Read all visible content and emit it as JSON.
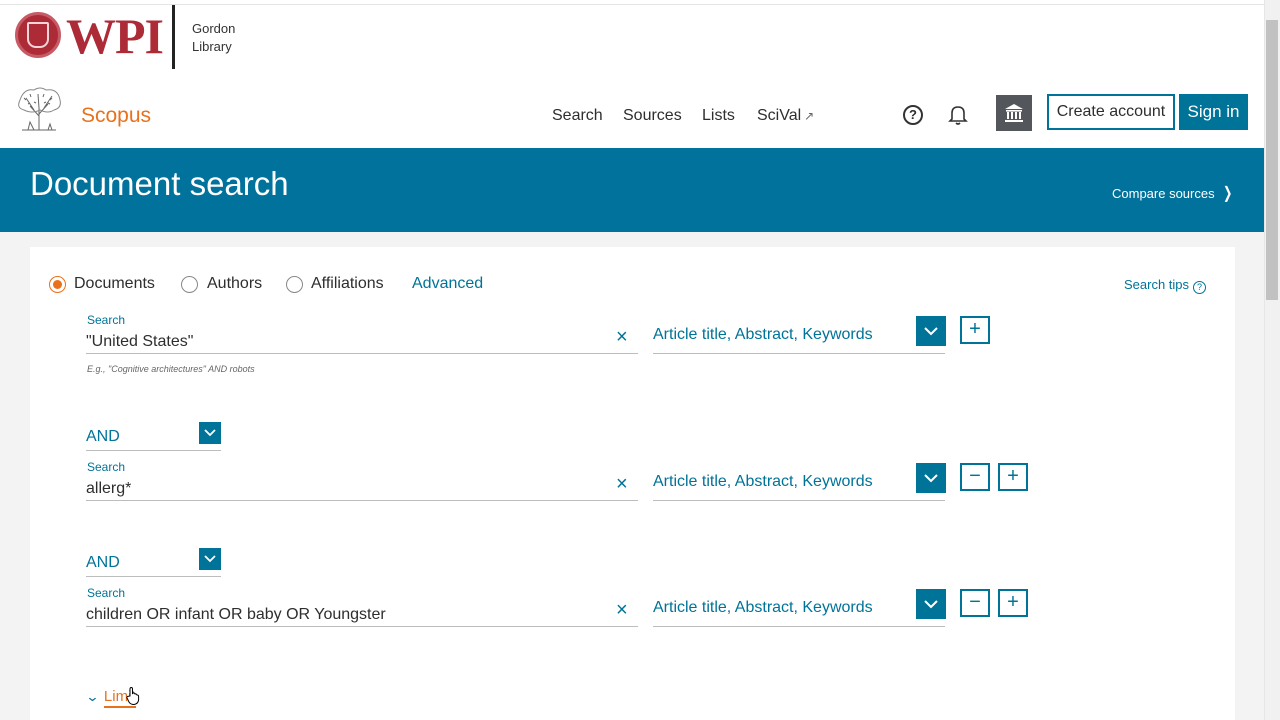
{
  "library": {
    "logo_text": "WPI",
    "name_line1": "Gordon",
    "name_line2": "Library"
  },
  "header": {
    "product": "Scopus",
    "nav": [
      {
        "label": "Search"
      },
      {
        "label": "Sources"
      },
      {
        "label": "Lists"
      },
      {
        "label": "SciVal",
        "external_icon": "arrow-up-right-icon"
      }
    ],
    "help_icon": "?",
    "create_account": "Create account",
    "sign_in": "Sign in"
  },
  "banner": {
    "title": "Document search",
    "compare": "Compare sources"
  },
  "search_type": {
    "options": [
      "Documents",
      "Authors",
      "Affiliations"
    ],
    "selected": "Documents",
    "advanced": "Advanced",
    "tips": "Search tips",
    "tips_icon": "?"
  },
  "rows": [
    {
      "label": "Search",
      "value": "\"United States\"",
      "hint": "E.g., \"Cognitive architectures\" AND robots",
      "scope": "Article title, Abstract, Keywords"
    },
    {
      "operator": "AND",
      "label": "Search",
      "value": "allerg*",
      "scope": "Article title, Abstract, Keywords"
    },
    {
      "operator": "AND",
      "label": "Search",
      "value": "children OR infant OR baby OR Youngster",
      "scope": "Article title, Abstract, Keywords"
    }
  ],
  "buttons": {
    "add": "+",
    "remove": "−",
    "clear": "×"
  },
  "limit": {
    "label": "Limit"
  },
  "colors": {
    "accent_blue": "#007398",
    "accent_orange": "#e9711c",
    "wpi_red": "#ac2b37"
  }
}
